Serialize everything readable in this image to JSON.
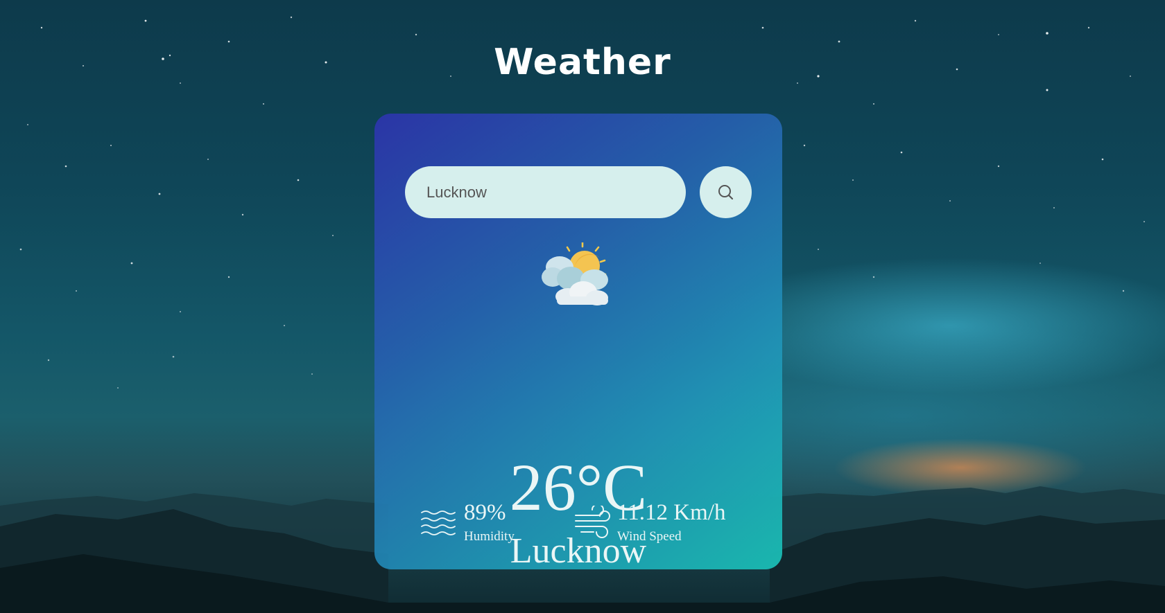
{
  "page": {
    "title": "Weather"
  },
  "search": {
    "value": "Lucknow",
    "button_icon": "search-icon"
  },
  "weather": {
    "condition_icon": "partly-cloudy-icon",
    "temperature": "26°C",
    "city": "Lucknow"
  },
  "details": {
    "humidity": {
      "icon": "waves-icon",
      "value": "89%",
      "label": "Humidity"
    },
    "wind": {
      "icon": "wind-icon",
      "value": "11.12 Km/h",
      "label": "Wind Speed"
    }
  },
  "colors": {
    "card_gradient_start": "#2c34aa",
    "card_gradient_end": "#1abeb4",
    "input_background": "#d6efed",
    "text_light": "#eaf6f6"
  }
}
